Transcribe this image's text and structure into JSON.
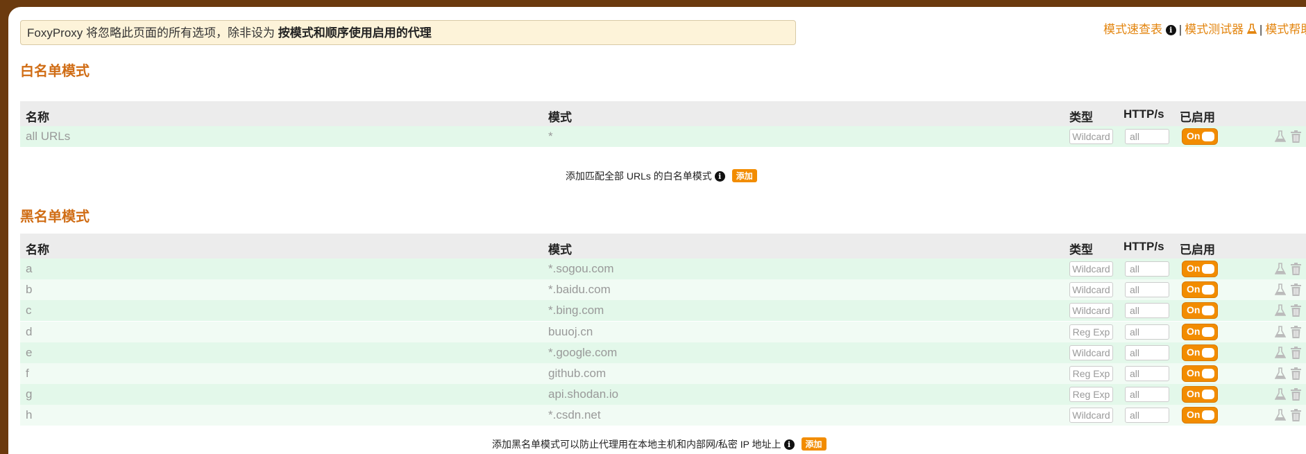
{
  "notice": {
    "prefix": "FoxyProxy 将忽略此页面的所有选项，除非设为 ",
    "bold": "按模式和顺序使用启用的代理"
  },
  "top_links": {
    "cheatsheet": "模式速查表",
    "tester": "模式测试器",
    "help": "模式帮助"
  },
  "whitelist": {
    "title": "白名单模式",
    "headers": {
      "name": "名称",
      "pattern": "模式",
      "type": "类型",
      "http": "HTTP/s",
      "enabled": "已启用"
    },
    "rows": [
      {
        "name": "all URLs",
        "pattern": "*",
        "type": "Wildcard",
        "http": "all",
        "enabled": "On"
      }
    ],
    "add_text": "添加匹配全部 URLs 的白名单模式",
    "add_button": "添加"
  },
  "blacklist": {
    "title": "黑名单模式",
    "headers": {
      "name": "名称",
      "pattern": "模式",
      "type": "类型",
      "http": "HTTP/s",
      "enabled": "已启用"
    },
    "rows": [
      {
        "name": "a",
        "pattern": "*.sogou.com",
        "type": "Wildcard",
        "http": "all",
        "enabled": "On"
      },
      {
        "name": "b",
        "pattern": "*.baidu.com",
        "type": "Wildcard",
        "http": "all",
        "enabled": "On"
      },
      {
        "name": "c",
        "pattern": "*.bing.com",
        "type": "Wildcard",
        "http": "all",
        "enabled": "On"
      },
      {
        "name": "d",
        "pattern": "buuoj.cn",
        "type": "Reg Exp",
        "http": "all",
        "enabled": "On"
      },
      {
        "name": "e",
        "pattern": "*.google.com",
        "type": "Wildcard",
        "http": "all",
        "enabled": "On"
      },
      {
        "name": "f",
        "pattern": "github.com",
        "type": "Reg Exp",
        "http": "all",
        "enabled": "On"
      },
      {
        "name": "g",
        "pattern": "api.shodan.io",
        "type": "Reg Exp",
        "http": "all",
        "enabled": "On"
      },
      {
        "name": "h",
        "pattern": "*.csdn.net",
        "type": "Wildcard",
        "http": "all",
        "enabled": "On"
      }
    ],
    "add_text": "添加黑名单模式可以防止代理用在本地主机和内部网/私密 IP 地址上",
    "add_button": "添加"
  },
  "colors": {
    "accent": "#f28c00",
    "title": "#d06d15",
    "frame": "#6b3a0e",
    "row_odd": "#e3f8ea",
    "row_even": "#f1fbf4"
  }
}
